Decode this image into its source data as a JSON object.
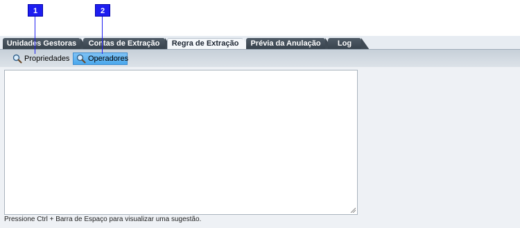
{
  "callouts": [
    "1",
    "2"
  ],
  "tabs": [
    {
      "label": "Unidades Gestoras"
    },
    {
      "label": "Contas de Extração"
    },
    {
      "label": "Regra de Extração",
      "active": true
    },
    {
      "label": "Prévia da Anulação"
    },
    {
      "label": "Log"
    }
  ],
  "toolbar": {
    "properties_label": "Propriedades",
    "operators_label": "Operadores"
  },
  "editor": {
    "value": "",
    "hint": "Pressione Ctrl + Barra de Espaço para visualizar uma sugestão."
  },
  "colors": {
    "callout": "#1d1df0",
    "tab_dark": "#3f4a54",
    "selected_button": "#4aa7ec"
  }
}
